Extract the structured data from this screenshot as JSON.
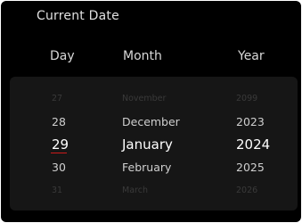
{
  "title": "Current Date",
  "columns": {
    "day": "Day",
    "month": "Month",
    "year": "Year"
  },
  "rows": [
    {
      "day": "27",
      "month": "November",
      "year": "2099"
    },
    {
      "day": "28",
      "month": "December",
      "year": "2023"
    },
    {
      "day": "29",
      "month": "January",
      "year": "2024"
    },
    {
      "day": "30",
      "month": "February",
      "year": "2025"
    },
    {
      "day": "31",
      "month": "March",
      "year": "2026"
    }
  ],
  "selected_index": 2,
  "colors": {
    "background": "#000000",
    "wheel_background": "#161616",
    "selection_accent": "#cc1a1a",
    "selected_text": "#ffffff",
    "dim_text": "#3a3a3a"
  }
}
